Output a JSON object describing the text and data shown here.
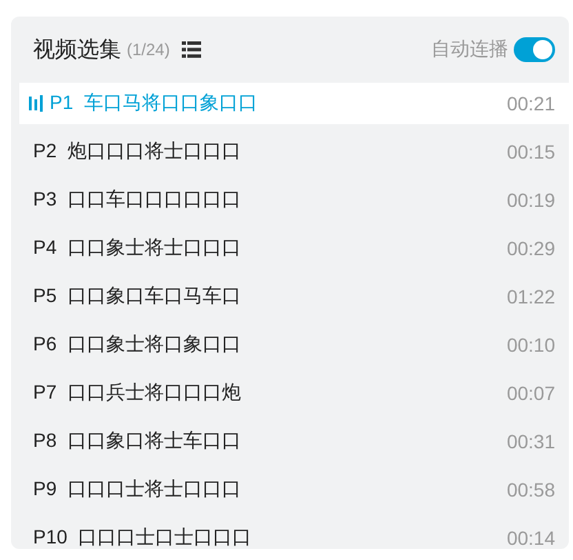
{
  "header": {
    "title": "视频选集",
    "count": "(1/24)",
    "autoplay_label": "自动连播",
    "autoplay_on": true
  },
  "episodes": [
    {
      "number": "P1",
      "title": "车口马将口口象口口",
      "duration": "00:21",
      "selected": true
    },
    {
      "number": "P2",
      "title": "炮口口口将士口口口",
      "duration": "00:15",
      "selected": false
    },
    {
      "number": "P3",
      "title": "口口车口口口口口口",
      "duration": "00:19",
      "selected": false
    },
    {
      "number": "P4",
      "title": "口口象士将士口口口",
      "duration": "00:29",
      "selected": false
    },
    {
      "number": "P5",
      "title": "口口象口车口马车口",
      "duration": "01:22",
      "selected": false
    },
    {
      "number": "P6",
      "title": "口口象士将口象口口",
      "duration": "00:10",
      "selected": false
    },
    {
      "number": "P7",
      "title": "口口兵士将口口口炮",
      "duration": "00:07",
      "selected": false
    },
    {
      "number": "P8",
      "title": "口口象口将士车口口",
      "duration": "00:31",
      "selected": false
    },
    {
      "number": "P9",
      "title": "口口口士将士口口口",
      "duration": "00:58",
      "selected": false
    },
    {
      "number": "P10",
      "title": "口口口士口士口口口",
      "duration": "00:14",
      "selected": false
    }
  ]
}
